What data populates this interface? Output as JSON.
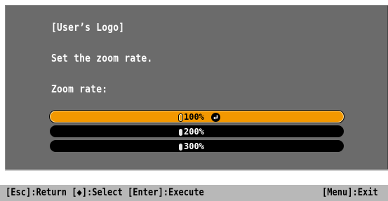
{
  "dialog": {
    "title": "[User’s Logo]",
    "instruction": "Set the zoom rate.",
    "field_label": "Zoom rate:",
    "options": [
      {
        "label": "100%",
        "selected": true
      },
      {
        "label": "200%",
        "selected": false
      },
      {
        "label": "300%",
        "selected": false
      }
    ],
    "enter_icon": "enter-return-icon",
    "colors": {
      "panel": "#6b6b6b",
      "highlight": "#f39800",
      "option_bg": "#000000",
      "status_bar": "#b8b8b8"
    }
  },
  "status_bar": {
    "left_text": "[Esc]:Return [◆]:Select [Enter]:Execute",
    "right_text": "[Menu]:Exit"
  }
}
